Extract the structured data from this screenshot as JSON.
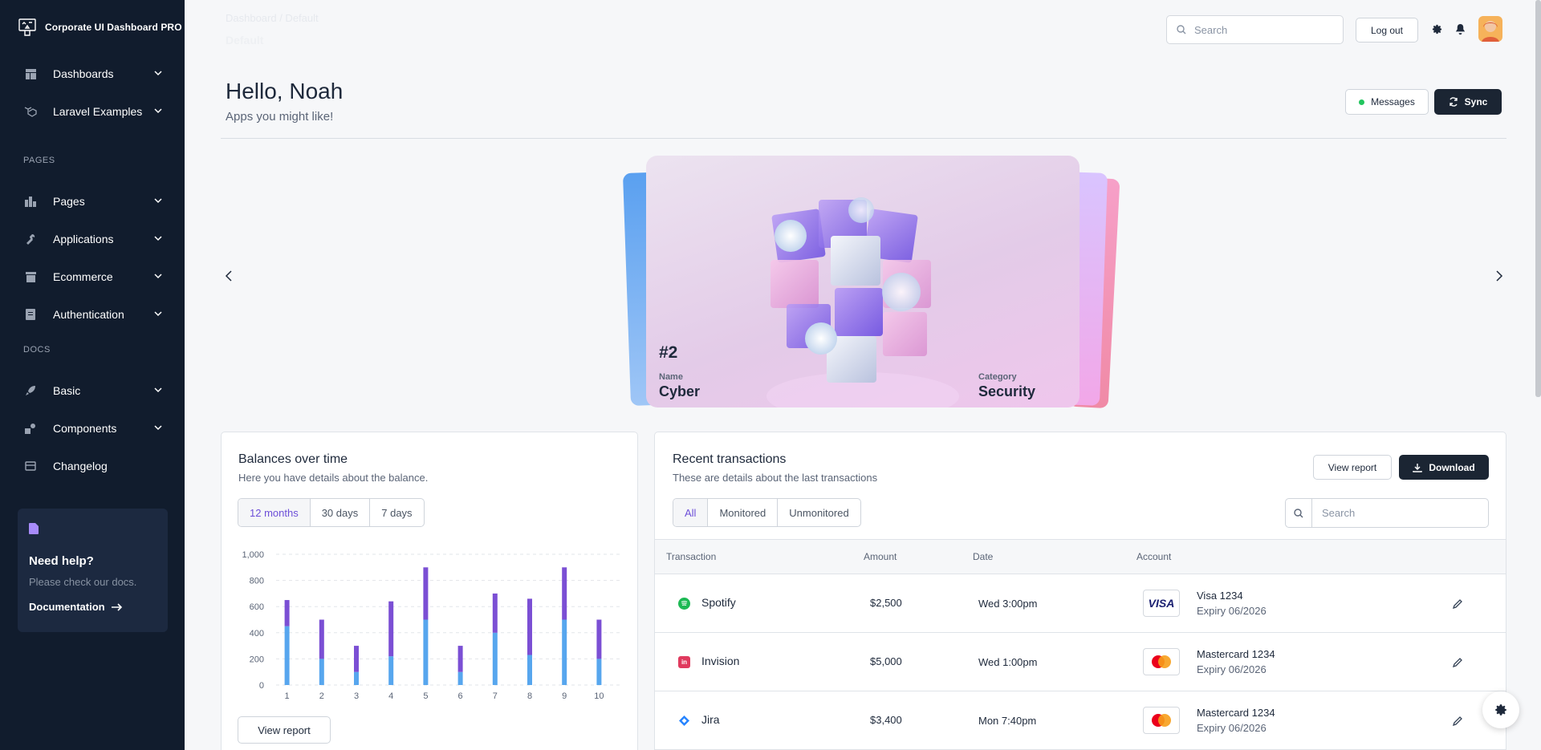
{
  "app": {
    "title": "Corporate UI Dashboard PRO"
  },
  "sidebar": {
    "items": [
      {
        "label": "Dashboards",
        "icon": "dashboard-icon"
      },
      {
        "label": "Laravel Examples",
        "icon": "laravel-icon"
      },
      {
        "label": "Pages",
        "icon": "pages-icon"
      },
      {
        "label": "Applications",
        "icon": "tools-icon"
      },
      {
        "label": "Ecommerce",
        "icon": "shop-icon"
      },
      {
        "label": "Authentication",
        "icon": "document-icon"
      },
      {
        "label": "Basic",
        "icon": "rocket-icon"
      },
      {
        "label": "Components",
        "icon": "components-icon"
      },
      {
        "label": "Changelog",
        "icon": "changelog-icon"
      }
    ],
    "sections": {
      "pages": "PAGES",
      "docs": "DOCS"
    },
    "help": {
      "title": "Need help?",
      "text": "Please check our docs.",
      "link": "Documentation"
    }
  },
  "header": {
    "breadcrumb": "Dashboard / Default",
    "subtitle": "Default",
    "search_placeholder": "Search",
    "logout": "Log out"
  },
  "greeting": {
    "title": "Hello, Noah",
    "subtitle": "Apps you might like!",
    "messages_label": "Messages",
    "sync_label": "Sync"
  },
  "carousel": {
    "rank": "#2",
    "name_label": "Name",
    "name": "Cyber",
    "category_label": "Category",
    "category": "Security"
  },
  "balances": {
    "title": "Balances over time",
    "subtitle": "Here you have details about the balance.",
    "ranges": [
      "12 months",
      "30 days",
      "7 days"
    ],
    "active_range": "12 months",
    "view_report": "View report"
  },
  "chart_data": {
    "type": "bar",
    "stacked": true,
    "categories": [
      "1",
      "2",
      "3",
      "4",
      "5",
      "6",
      "7",
      "8",
      "9",
      "10"
    ],
    "series": [
      {
        "color": "#57a6ee",
        "values": [
          450,
          200,
          100,
          220,
          500,
          100,
          400,
          230,
          500,
          200
        ]
      },
      {
        "color": "#7b4fd4",
        "values": [
          200,
          300,
          200,
          420,
          400,
          200,
          300,
          430,
          400,
          300
        ]
      }
    ],
    "y_ticks": [
      "1,000",
      "800",
      "600",
      "400",
      "200",
      "0"
    ],
    "ylim": [
      0,
      1000
    ],
    "grid": true
  },
  "transactions": {
    "title": "Recent transactions",
    "subtitle": "These are details about the last transactions",
    "view_report": "View report",
    "download": "Download",
    "filters": [
      "All",
      "Monitored",
      "Unmonitored"
    ],
    "active_filter": "All",
    "search_placeholder": "Search",
    "columns": [
      "Transaction",
      "Amount",
      "Date",
      "Account"
    ],
    "rows": [
      {
        "name": "Spotify",
        "amount": "$2,500",
        "date": "Wed 3:00pm",
        "account": "Visa 1234",
        "expiry": "Expiry 06/2026",
        "card": "VISA"
      },
      {
        "name": "Invision",
        "amount": "$5,000",
        "date": "Wed 1:00pm",
        "account": "Mastercard 1234",
        "expiry": "Expiry 06/2026",
        "card": "mastercard"
      },
      {
        "name": "Jira",
        "amount": "$3,400",
        "date": "Mon 7:40pm",
        "account": "Mastercard 1234",
        "expiry": "Expiry 06/2026",
        "card": "mastercard"
      }
    ]
  }
}
